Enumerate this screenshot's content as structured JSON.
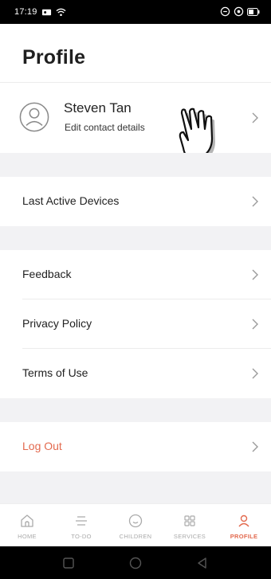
{
  "status_bar": {
    "time": "17:19"
  },
  "header": {
    "title": "Profile"
  },
  "profile": {
    "name": "Steven Tan",
    "subtitle": "Edit contact details"
  },
  "menu": {
    "last_active_devices": "Last Active Devices",
    "feedback": "Feedback",
    "privacy_policy": "Privacy Policy",
    "terms_of_use": "Terms of Use",
    "log_out": "Log Out"
  },
  "bottom_nav": [
    {
      "label": "HOME",
      "icon": "home-icon",
      "active": false
    },
    {
      "label": "TO-DO",
      "icon": "list-icon",
      "active": false
    },
    {
      "label": "CHILDREN",
      "icon": "smiley-icon",
      "active": false
    },
    {
      "label": "SERVICES",
      "icon": "grid-icon",
      "active": false
    },
    {
      "label": "PROFILE",
      "icon": "person-icon",
      "active": true
    }
  ],
  "colors": {
    "accent": "#e36a4f",
    "section_gap": "#f2f2f4",
    "inactive_nav": "#aaaaaa"
  }
}
